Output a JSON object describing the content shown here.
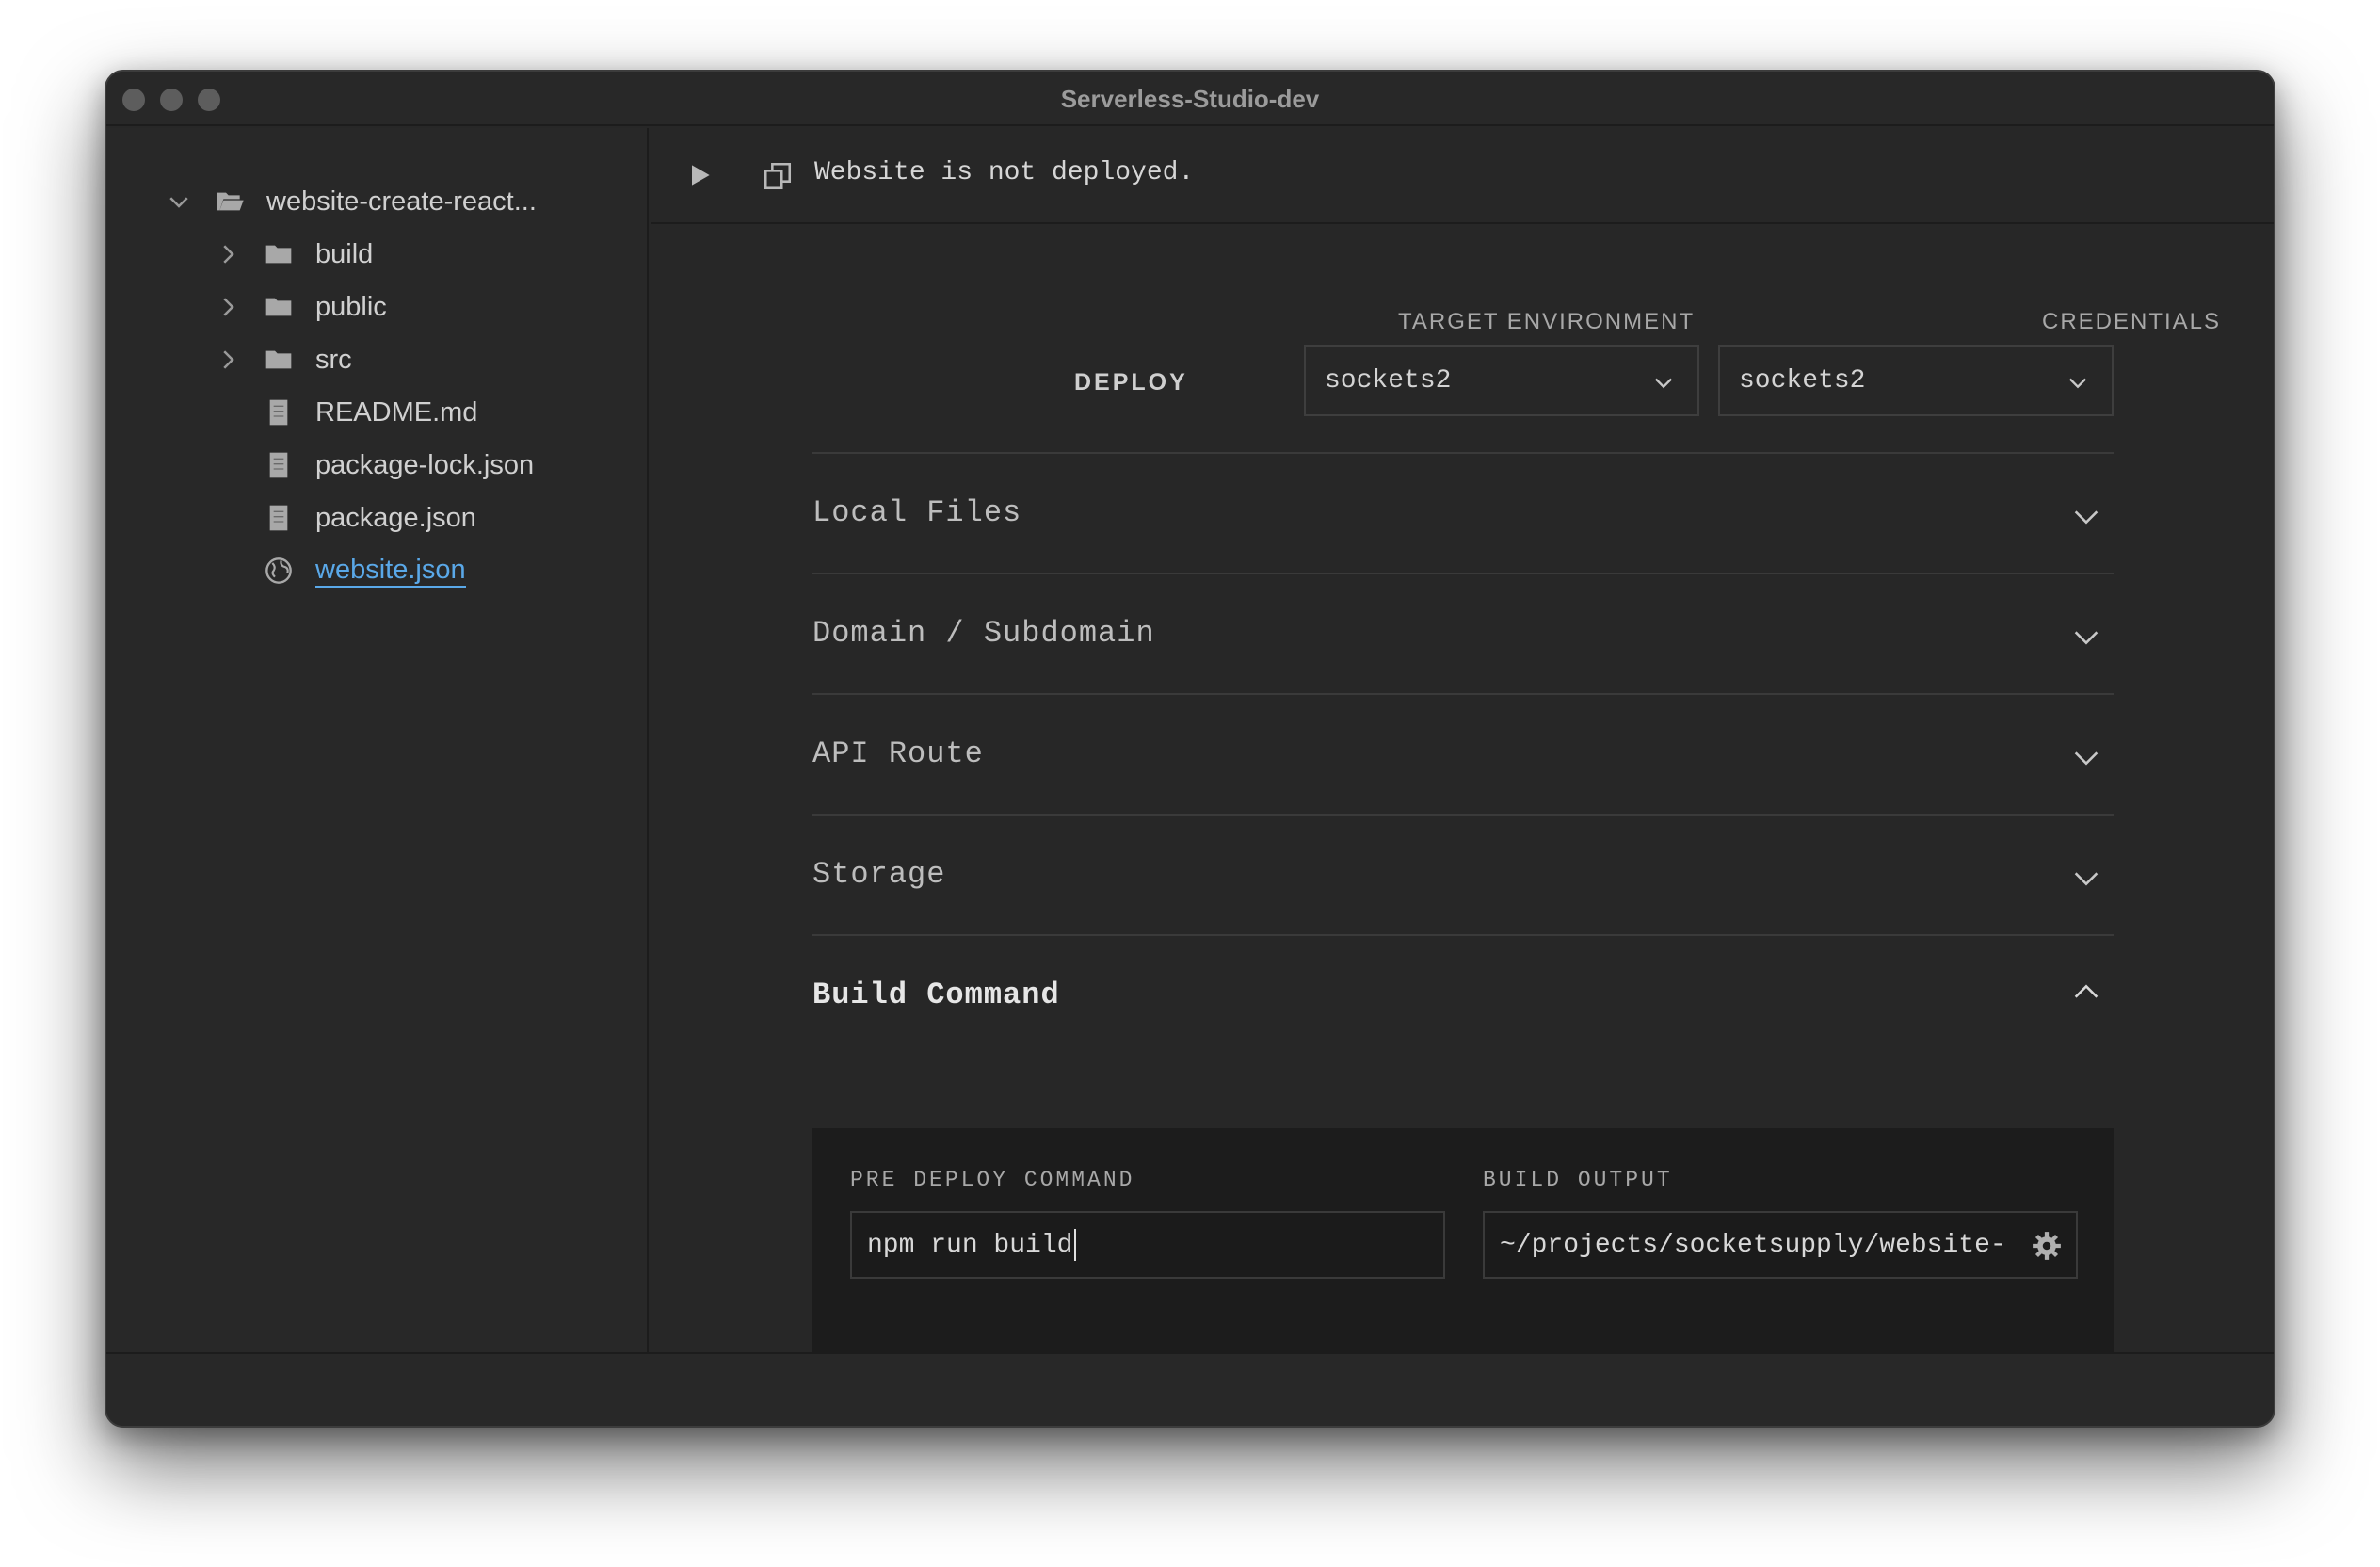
{
  "window": {
    "title": "Serverless-Studio-dev"
  },
  "sidebar": {
    "root": {
      "label": "website-create-react..."
    },
    "items": [
      {
        "label": "build",
        "type": "folder"
      },
      {
        "label": "public",
        "type": "folder"
      },
      {
        "label": "src",
        "type": "folder"
      },
      {
        "label": "README.md",
        "type": "file"
      },
      {
        "label": "package-lock.json",
        "type": "file"
      },
      {
        "label": "package.json",
        "type": "file"
      },
      {
        "label": "website.json",
        "type": "globe",
        "active": true
      }
    ]
  },
  "toolbar": {
    "status": "Website is not deployed."
  },
  "deploy": {
    "label": "DEPLOY",
    "target_label": "TARGET ENVIRONMENT",
    "credentials_label": "CREDENTIALS",
    "target_value": "sockets2",
    "credentials_value": "sockets2"
  },
  "sections": [
    {
      "title": "Local Files"
    },
    {
      "title": "Domain / Subdomain"
    },
    {
      "title": "API Route"
    },
    {
      "title": "Storage"
    },
    {
      "title": "Build Command"
    }
  ],
  "build": {
    "pre_deploy_label": "PRE DEPLOY COMMAND",
    "pre_deploy_value": "npm run build",
    "output_label": "BUILD OUTPUT",
    "output_value": "~/projects/socketsupply/website-"
  },
  "colors": {
    "link": "#5aa8e8",
    "background": "#272727",
    "panel": "#1c1c1c"
  }
}
